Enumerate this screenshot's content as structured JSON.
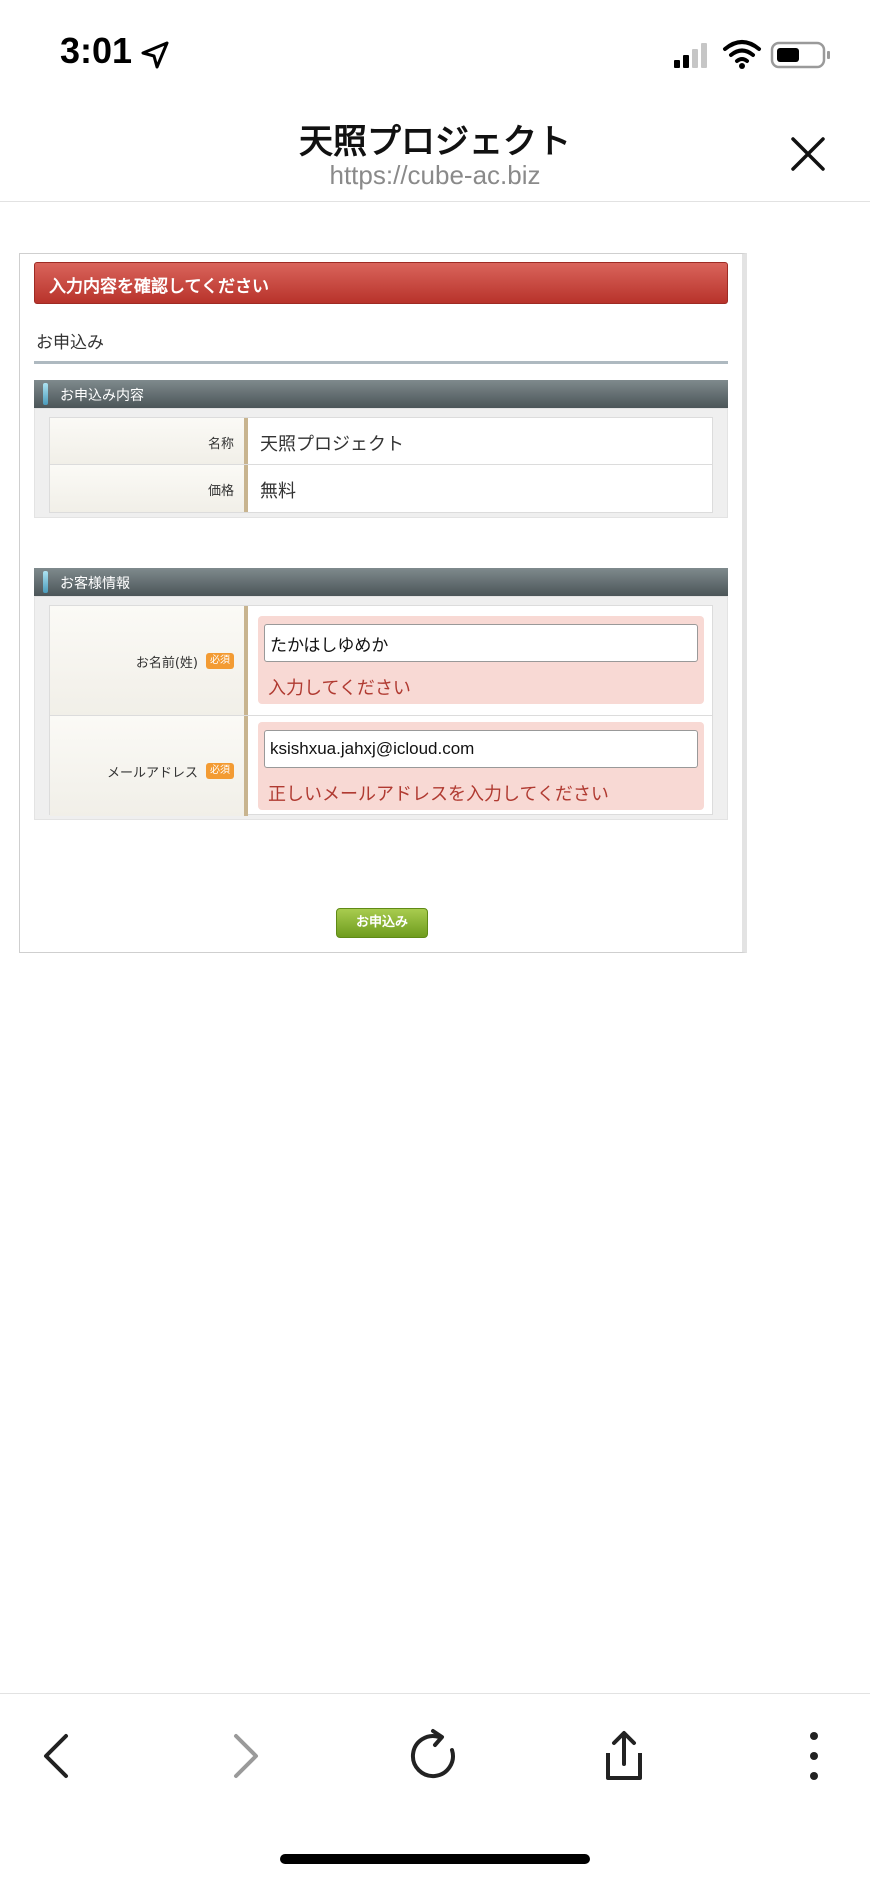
{
  "status_bar": {
    "time": "3:01"
  },
  "header": {
    "title": "天照プロジェクト",
    "url": "https://cube-ac.biz"
  },
  "form": {
    "alert": "入力内容を確認してください",
    "section_title": "お申込み",
    "order_band": "お申込み内容",
    "order_rows": [
      {
        "label": "名称",
        "value": "天照プロジェクト"
      },
      {
        "label": "価格",
        "value": "無料"
      }
    ],
    "customer_band": "お客様情報",
    "required_label": "必須",
    "customer_fields": [
      {
        "label": "お名前(姓)",
        "value": "たかはしゆめか",
        "error": "入力してください"
      },
      {
        "label": "メールアドレス",
        "value": "ksishxua.jahxj@icloud.com",
        "error": "正しいメールアドレスを入力してください"
      }
    ],
    "submit_label": "お申込み"
  },
  "colors": {
    "alert": "#c9463e",
    "error_bg": "#f8d9d4",
    "submit": "#8cb637",
    "badge": "#f39b33"
  }
}
